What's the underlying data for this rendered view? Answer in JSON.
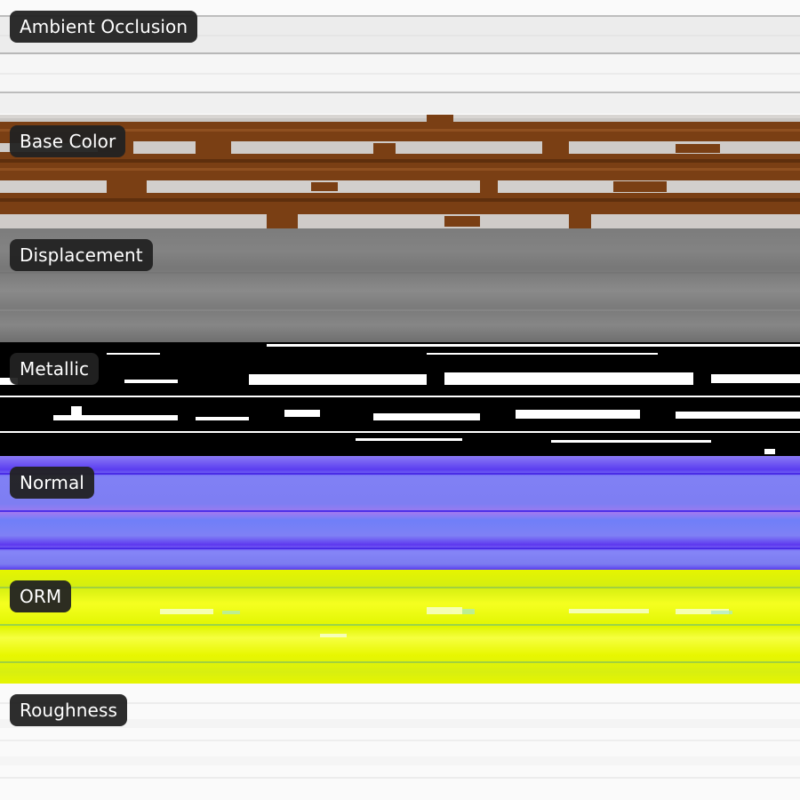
{
  "maps": [
    {
      "id": "ambient-occlusion",
      "label": "Ambient Occlusion",
      "color": "#f2f2f2",
      "shade": "#c8c8c8"
    },
    {
      "id": "base-color",
      "label": "Base Color",
      "color": "#7a3f14",
      "shade": "#c9c6c3"
    },
    {
      "id": "displacement",
      "label": "Displacement",
      "color": "#7b7b7b",
      "shade": "#8c8c8c"
    },
    {
      "id": "metallic",
      "label": "Metallic",
      "color": "#000000",
      "shade": "#ffffff"
    },
    {
      "id": "normal",
      "label": "Normal",
      "color": "#7f7ff0",
      "shade": "#5a3cf0"
    },
    {
      "id": "orm",
      "label": "ORM",
      "color": "#e8f500",
      "shade": "#f5ff20"
    },
    {
      "id": "roughness",
      "label": "Roughness",
      "color": "#fafafa",
      "shade": "#ededed"
    }
  ]
}
